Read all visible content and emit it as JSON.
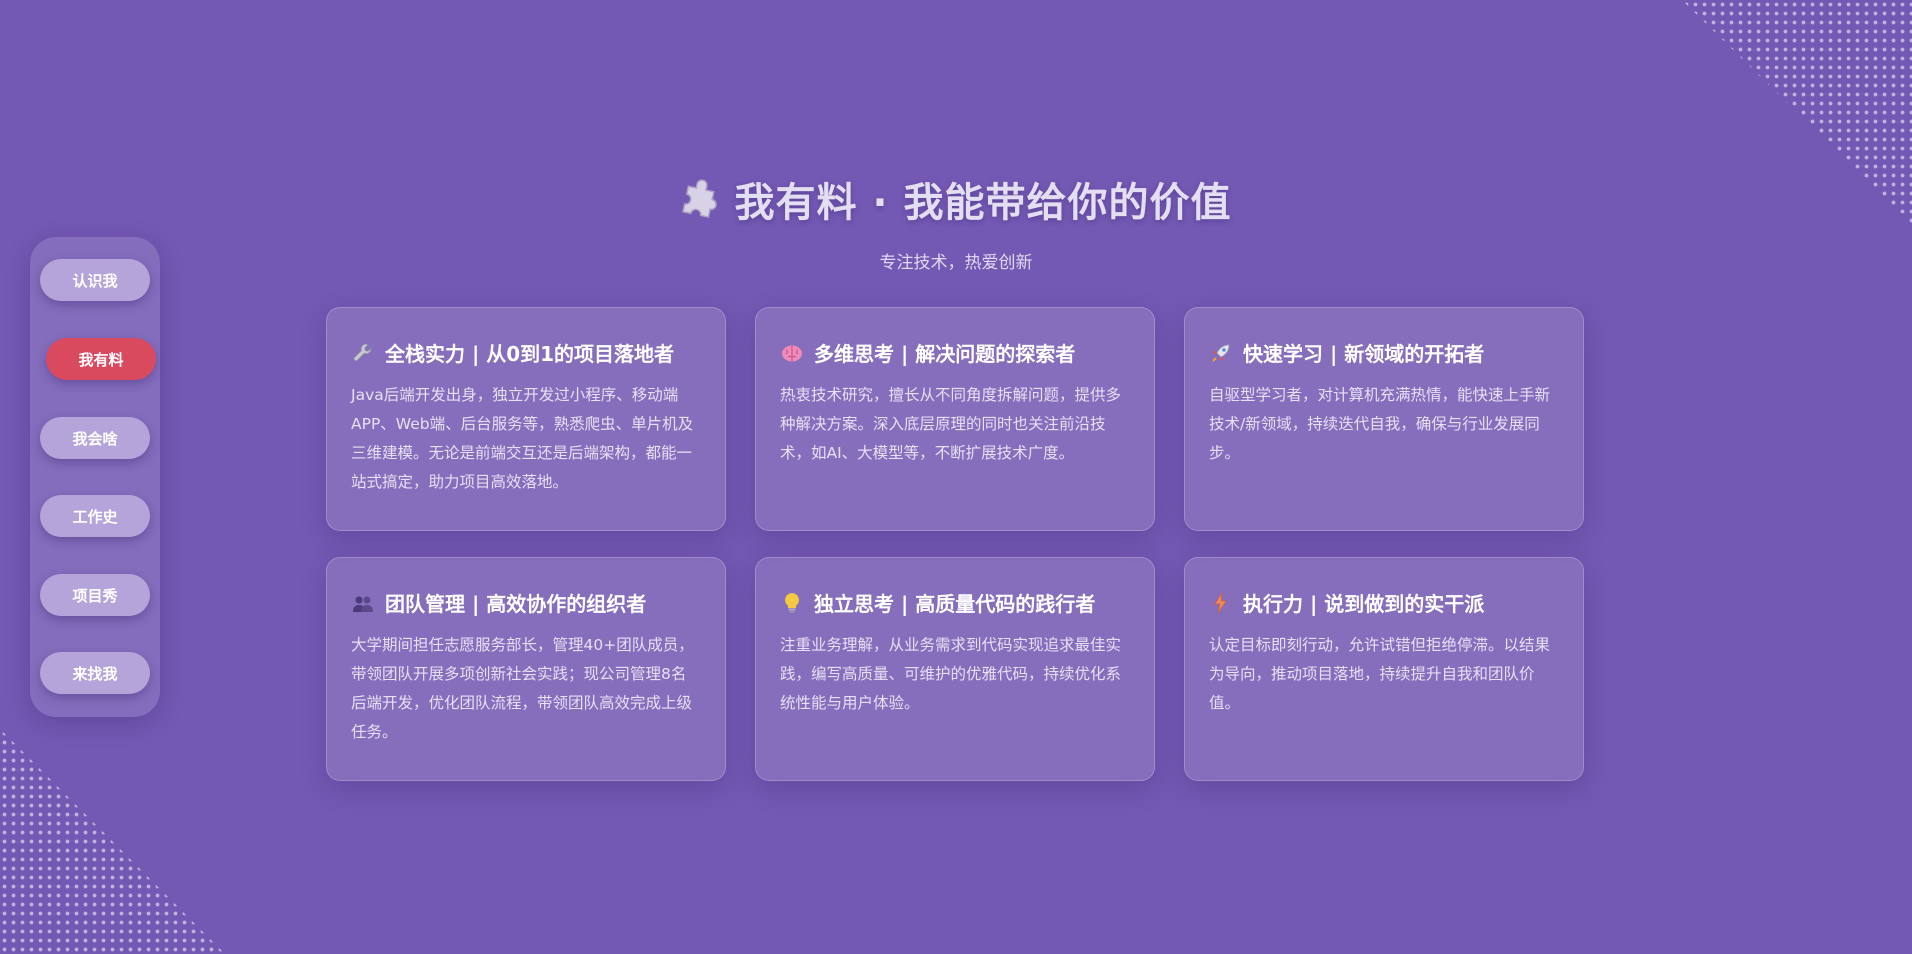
{
  "colors": {
    "background": "#7459b4",
    "active_nav": "#d94a5f",
    "nav_button": "#cfc4e8"
  },
  "nav": {
    "items": [
      {
        "label": "认识我",
        "active": false
      },
      {
        "label": "我有料",
        "active": true
      },
      {
        "label": "我会啥",
        "active": false
      },
      {
        "label": "工作史",
        "active": false
      },
      {
        "label": "项目秀",
        "active": false
      },
      {
        "label": "来找我",
        "active": false
      }
    ]
  },
  "header": {
    "icon": "puzzle-piece-icon",
    "title": "我有料 · 我能带给你的价值",
    "subtitle": "专注技术，热爱创新"
  },
  "cards": [
    {
      "icon": "wrench-icon",
      "title": "全栈实力 | 从0到1的项目落地者",
      "desc": "Java后端开发出身，独立开发过小程序、移动端APP、Web端、后台服务等，熟悉爬虫、单片机及三维建模。无论是前端交互还是后端架构，都能一站式搞定，助力项目高效落地。"
    },
    {
      "icon": "brain-icon",
      "title": "多维思考 | 解决问题的探索者",
      "desc": "热衷技术研究，擅长从不同角度拆解问题，提供多种解决方案。深入底层原理的同时也关注前沿技术，如AI、大模型等，不断扩展技术广度。"
    },
    {
      "icon": "rocket-icon",
      "title": "快速学习 | 新领域的开拓者",
      "desc": "自驱型学习者，对计算机充满热情，能快速上手新技术/新领域，持续迭代自我，确保与行业发展同步。"
    },
    {
      "icon": "team-icon",
      "title": "团队管理 | 高效协作的组织者",
      "desc": "大学期间担任志愿服务部长，管理40+团队成员，带领团队开展多项创新社会实践；现公司管理8名后端开发，优化团队流程，带领团队高效完成上级任务。"
    },
    {
      "icon": "lightbulb-icon",
      "title": "独立思考 | 高质量代码的践行者",
      "desc": "注重业务理解，从业务需求到代码实现追求最佳实践，编写高质量、可维护的优雅代码，持续优化系统性能与用户体验。"
    },
    {
      "icon": "lightning-icon",
      "title": "执行力 | 说到做到的实干派",
      "desc": "认定目标即刻行动，允许试错但拒绝停滞。以结果为导向，推动项目落地，持续提升自我和团队价值。"
    }
  ]
}
